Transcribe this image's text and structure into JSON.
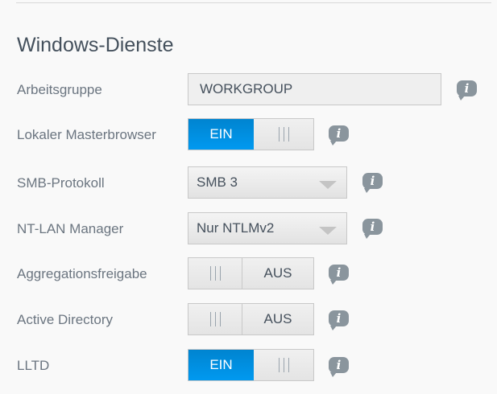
{
  "section_title": "Windows-Dienste",
  "info_glyph": "i",
  "workgroup": {
    "label": "Arbeitsgruppe",
    "value": "WORKGROUP"
  },
  "master_browser": {
    "label": "Lokaler Masterbrowser",
    "state": "EIN"
  },
  "smb": {
    "label": "SMB-Protokoll",
    "value": "SMB 3"
  },
  "ntlm": {
    "label": "NT-LAN Manager",
    "value": "Nur NTLMv2"
  },
  "aggregation": {
    "label": "Aggregationsfreigabe",
    "state": "AUS"
  },
  "active_directory": {
    "label": "Active Directory",
    "state": "AUS"
  },
  "lltd": {
    "label": "LLTD",
    "state": "EIN"
  }
}
